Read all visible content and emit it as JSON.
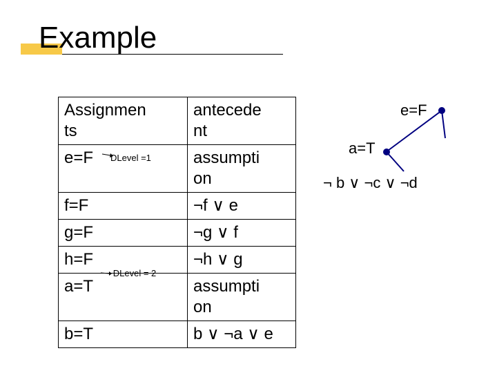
{
  "title": "Example",
  "table": {
    "headers": {
      "assignments": "Assignmen\nts",
      "antecedent": "antecede\nnt"
    },
    "rows": [
      {
        "assign": "e=F",
        "ante": "assumpti\non"
      },
      {
        "assign": "f=F",
        "ante": "¬f ∨ e"
      },
      {
        "assign": "g=F",
        "ante": "¬g ∨ f"
      },
      {
        "assign": "h=F",
        "ante": "¬h ∨ g"
      },
      {
        "assign": "a=T",
        "ante": "assumpti\non"
      },
      {
        "assign": "b=T",
        "ante": "b ∨ ¬a ∨ e"
      }
    ]
  },
  "dlevels": {
    "one": "DLevel =1",
    "two": "DLevel = 2"
  },
  "graph": {
    "nodes": {
      "eF": "e=F",
      "aT": "a=T"
    },
    "clause": "¬ b ∨ ¬c ∨ ¬d"
  },
  "chart_data": {
    "type": "table",
    "title": "Example",
    "columns": [
      "Assignments",
      "antecedent"
    ],
    "rows": [
      [
        "e=F",
        "assumption"
      ],
      [
        "f=F",
        "¬f ∨ e"
      ],
      [
        "g=F",
        "¬g ∨ f"
      ],
      [
        "h=F",
        "¬h ∨ g"
      ],
      [
        "a=T",
        "assumption"
      ],
      [
        "b=T",
        "b ∨ ¬a ∨ e"
      ]
    ],
    "dlevels": {
      "e=F": 1,
      "a=T": 2
    },
    "implication_graph": {
      "nodes": [
        "e=F",
        "a=T"
      ],
      "edges": [
        [
          "e=F",
          "a=T"
        ],
        [
          "e=F",
          "clause"
        ],
        [
          "a=T",
          "clause"
        ]
      ],
      "clause": "¬b ∨ ¬c ∨ ¬d"
    }
  }
}
